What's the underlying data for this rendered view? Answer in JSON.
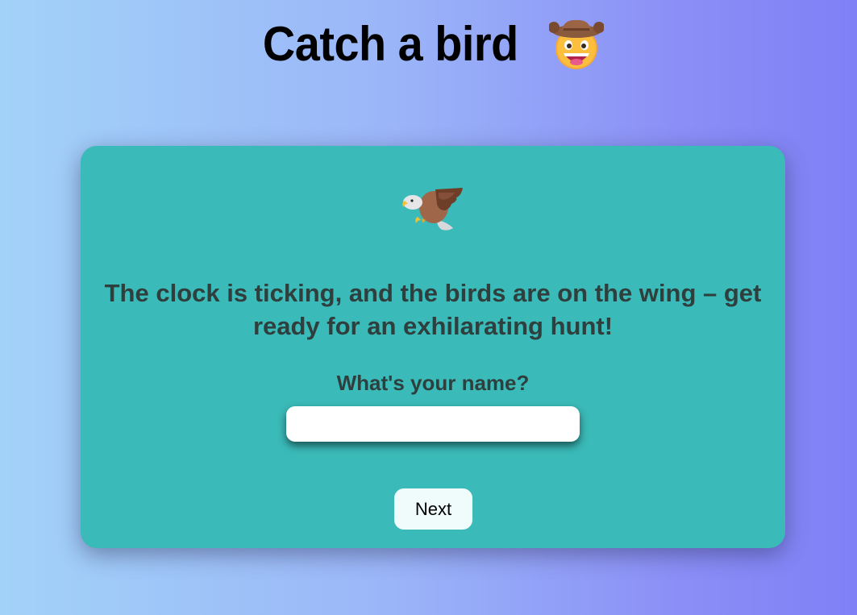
{
  "page": {
    "title": "Catch a bird",
    "title_icon": "cowboy-hat-face-icon"
  },
  "card": {
    "bird_icon": "eagle-icon",
    "tagline": "The clock is ticking, and the birds are on the wing – get ready for an exhilarating hunt!",
    "name_label": "What's your name?",
    "name_input": {
      "value": "",
      "placeholder": ""
    },
    "next_label": "Next"
  },
  "colors": {
    "background_left": "#a2d2f8",
    "background_right": "#7f80f6",
    "card": "#3abab8",
    "text": "#2f3f3d",
    "button": "#f0fcfc"
  }
}
